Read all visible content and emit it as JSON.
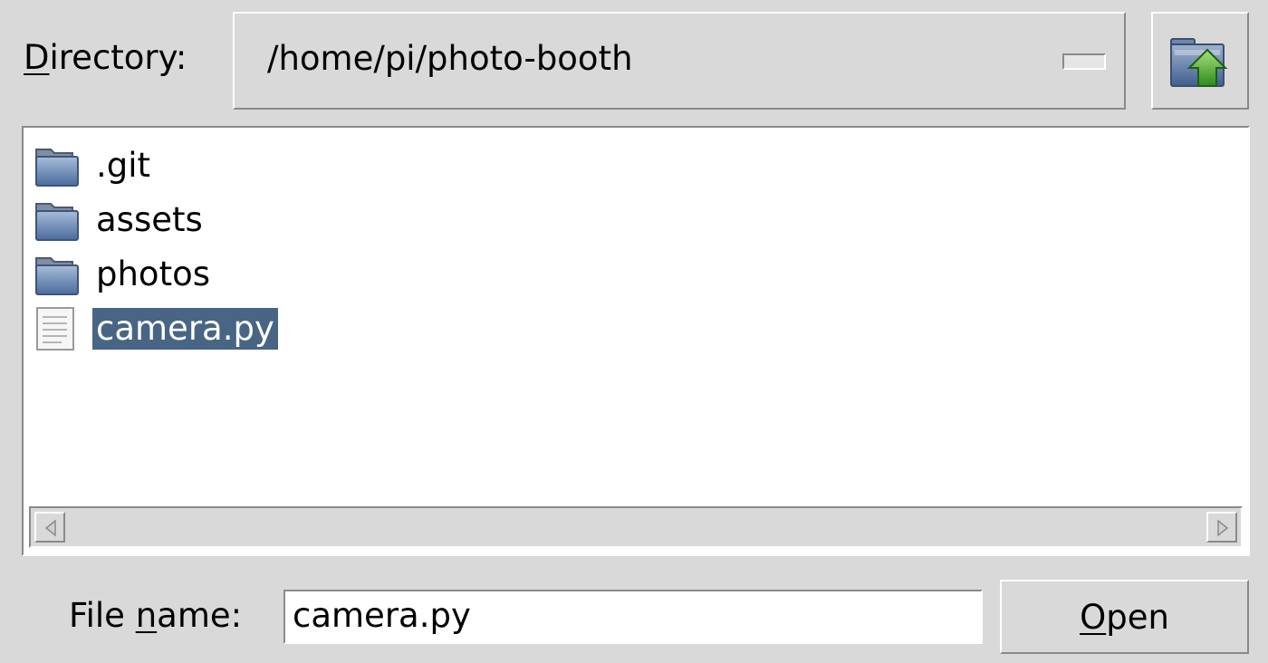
{
  "directory": {
    "label_underlined_char": "D",
    "label_rest": "irectory:",
    "path": "/home/pi/photo-booth",
    "up_button_icon": "folder-up-icon"
  },
  "file_list": {
    "items": [
      {
        "name": ".git",
        "type": "folder",
        "icon": "folder-icon",
        "selected": false
      },
      {
        "name": "assets",
        "type": "folder",
        "icon": "folder-icon",
        "selected": false
      },
      {
        "name": "photos",
        "type": "folder",
        "icon": "folder-icon",
        "selected": false
      },
      {
        "name": "camera.py",
        "type": "file",
        "icon": "text-file-icon",
        "selected": true
      }
    ],
    "selection_color": "#486585"
  },
  "file_name": {
    "label_prefix": "File ",
    "label_underlined_char": "n",
    "label_rest": "ame:",
    "value": "camera.py"
  },
  "open_button": {
    "underlined_char": "O",
    "rest": "pen"
  }
}
